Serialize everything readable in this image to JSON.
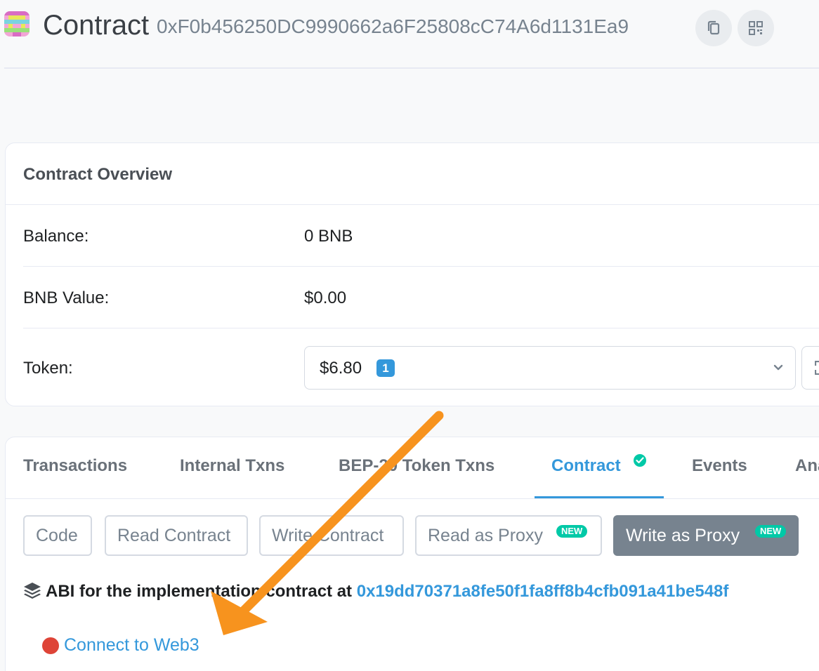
{
  "header": {
    "title": "Contract",
    "address": "0xF0b456250DC9990662a6F25808cC74A6d1131Ea9",
    "copy_icon": "copy-icon",
    "qr_icon": "qr-code-icon"
  },
  "overview": {
    "title": "Contract Overview",
    "rows": [
      {
        "label": "Balance:",
        "value": "0 BNB"
      },
      {
        "label": "BNB Value:",
        "value": "$0.00"
      },
      {
        "label": "Token:",
        "value": "$6.80",
        "badge": "1"
      }
    ]
  },
  "tabs": {
    "items": [
      {
        "label": "Transactions"
      },
      {
        "label": "Internal Txns"
      },
      {
        "label": "BEP-20 Token Txns"
      },
      {
        "label": "Contract",
        "active": true
      },
      {
        "label": "Events"
      },
      {
        "label": "Ana"
      }
    ]
  },
  "contract_buttons": {
    "items": [
      {
        "label": "Code"
      },
      {
        "label": "Read Contract"
      },
      {
        "label": "Write Contract"
      },
      {
        "label": "Read as Proxy",
        "badge": "NEW"
      },
      {
        "label": "Write as Proxy",
        "badge": "NEW",
        "active": true
      }
    ]
  },
  "abi": {
    "prefix": "ABI for the implementation contract at",
    "address": "0x19dd70371a8fe50f1fa8ff8b4cfb091a41be548f",
    "icon": "layers-icon"
  },
  "web3": {
    "label": "Connect to Web3",
    "status_color": "#de4437"
  },
  "colors": {
    "accent": "#3498db",
    "success": "#00c9a7",
    "annotation_arrow": "#f7931e"
  }
}
